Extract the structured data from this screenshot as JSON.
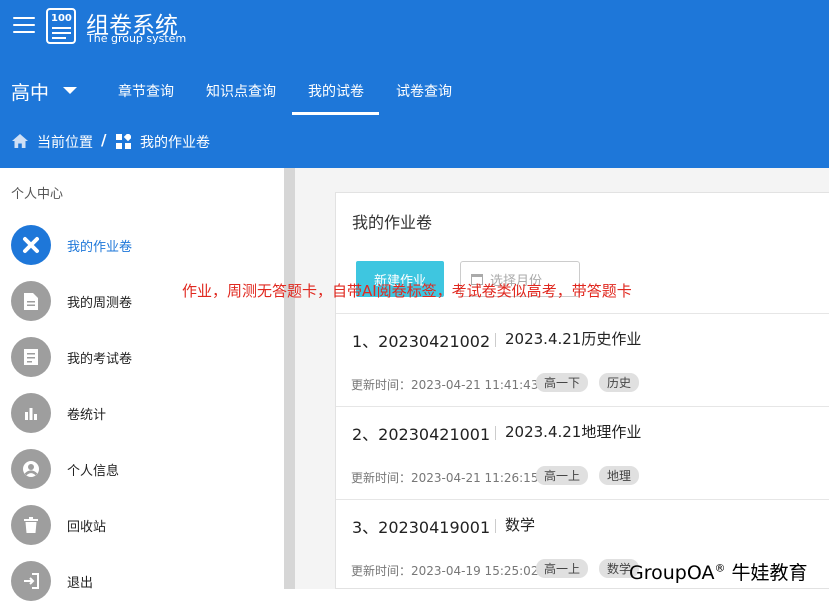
{
  "app": {
    "title": "组卷系统",
    "subtitle": "The group system",
    "logo_number": "100"
  },
  "grade": {
    "label": "高中"
  },
  "nav": {
    "items": [
      {
        "label": "章节查询"
      },
      {
        "label": "知识点查询"
      },
      {
        "label": "我的试卷"
      },
      {
        "label": "试卷查询"
      }
    ],
    "active": "我的试卷"
  },
  "breadcrumb": {
    "location": "当前位置",
    "separator": "/",
    "current": "我的作业卷"
  },
  "sidebar": {
    "header": "个人中心",
    "items": [
      {
        "label": "我的作业卷",
        "icon": "tools-icon"
      },
      {
        "label": "我的周测卷",
        "icon": "document-icon"
      },
      {
        "label": "我的考试卷",
        "icon": "exam-paper-icon"
      },
      {
        "label": "卷统计",
        "icon": "bar-chart-icon"
      },
      {
        "label": "个人信息",
        "icon": "user-icon"
      },
      {
        "label": "回收站",
        "icon": "trash-icon"
      },
      {
        "label": "退出",
        "icon": "logout-icon"
      }
    ]
  },
  "main": {
    "title": "我的作业卷",
    "new_button": "新建作业",
    "month_placeholder": "选择月份",
    "overlay_note": "作业，周测无答题卡，自带AI阅卷标签，考试卷类似高考，带答题卡",
    "papers": [
      {
        "index": "1、20230421002",
        "name": "2023.4.21历史作业",
        "updated": "更新时间：2023-04-21 11:41:43",
        "tags": [
          "高一下",
          "历史"
        ]
      },
      {
        "index": "2、20230421001",
        "name": "2023.4.21地理作业",
        "updated": "更新时间：2023-04-21 11:26:15",
        "tags": [
          "高一上",
          "地理"
        ]
      },
      {
        "index": "3、20230419001",
        "name": "数学",
        "updated": "更新时间：2023-04-19 15:25:02",
        "tags": [
          "高一上",
          "数学"
        ]
      }
    ]
  },
  "watermark": {
    "brand": "GroupOA",
    "mark": "®",
    "cn": "牛娃教育"
  },
  "colors": {
    "primary": "#1e77d9",
    "accent_button": "#3ec6e0",
    "overlay_text": "#e0281f"
  }
}
